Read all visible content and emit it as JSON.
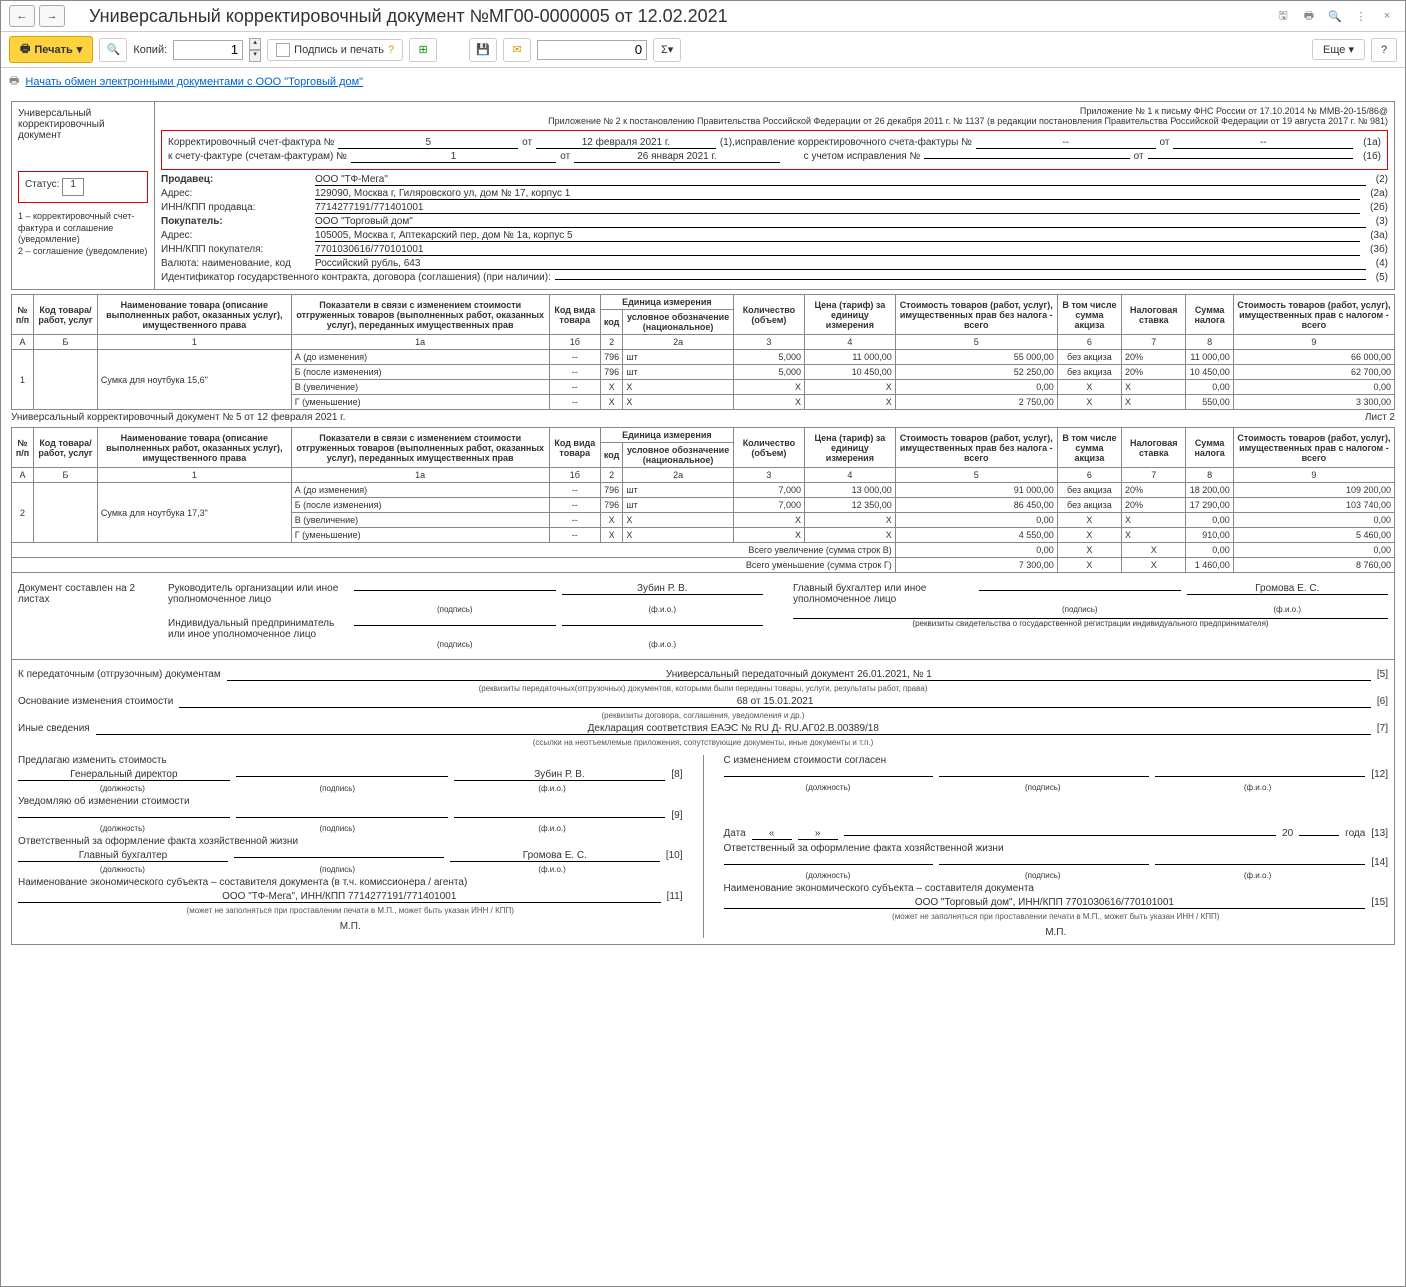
{
  "title": "Универсальный корректировочный документ №МГ00-0000005 от 12.02.2021",
  "toolbar": {
    "print": "Печать",
    "copies_label": "Копий:",
    "copies": "1",
    "sign": "Подпись и печать",
    "sum": "0",
    "more": "Еще",
    "help": "?"
  },
  "link": "Начать обмен электронными документами с ООО \"Торговый дом\"",
  "left": {
    "doc_type": "Универсальный корректировочный документ",
    "status_label": "Статус:",
    "status": "1",
    "legend": "1 – корректировочный счет-фактура и соглашение (уведомление)\n2 – соглашение (уведомление)"
  },
  "header": {
    "note1": "Приложение № 1 к письму ФНС России от 17.10.2014 № ММВ-20-15/86@",
    "note2": "Приложение № 2 к постановлению Правительства Российской Федерации от 26 декабря 2011 г. № 1137 (в редакции постановления Правительства Российской Федерации от 19 августа 2017 г. № 981)",
    "corr_sf_label": "Корректировочный счет-фактура №",
    "corr_sf_no": "5",
    "from": "от",
    "corr_sf_date": "12 февраля 2021 г.",
    "p1": "(1),",
    "ispr_label": "исправление корректировочного счета-фактуры №",
    "ispr_no": "--",
    "ispr_date": "--",
    "p1a": "(1а)",
    "to_sf_label": "к счету-фактуре (счетам-фактурам) №",
    "to_sf_no": "1",
    "to_sf_date": "26 января 2021 г.",
    "with_ispr": "с учетом исправления №",
    "p1b": "(1б)",
    "seller_label": "Продавец:",
    "seller": "ООО \"ТФ-Мега\"",
    "p2": "(2)",
    "addr_label": "Адрес:",
    "seller_addr": "129090, Москва г, Гиляровского ул, дом № 17, корпус 1",
    "p2a": "(2а)",
    "inn_s_label": "ИНН/КПП продавца:",
    "inn_s": "7714277191/771401001",
    "p2b": "(2б)",
    "buyer_label": "Покупатель:",
    "buyer": "ООО \"Торговый дом\"",
    "p3": "(3)",
    "buyer_addr": "105005, Москва г, Аптекарский пер, дом № 1а, корпус 5",
    "p3a": "(3а)",
    "inn_b_label": "ИНН/КПП покупателя:",
    "inn_b": "7701030616/770101001",
    "p3b": "(3б)",
    "currency_label": "Валюта: наименование, код",
    "currency": "Российский рубль, 643",
    "p4": "(4)",
    "gk_label": "Идентификатор государственного контракта, договора (соглашения) (при наличии):",
    "p5": "(5)"
  },
  "table_headers": {
    "n": "№ п/п",
    "code": "Код товара/ работ, услуг",
    "name": "Наименование товара (описание выполненных работ, оказанных услуг), имущественного права",
    "indicators": "Показатели в связи с изменением стоимости отгруженных товаров (выполненных работ, оказанных услуг), переданных имущественных прав",
    "code_type": "Код вида товара",
    "unit": "Единица измерения",
    "unit_code": "код",
    "unit_name": "условное обозначение (национальное)",
    "qty": "Количество (объем)",
    "price": "Цена (тариф) за единицу измерения",
    "cost_wo": "Стоимость товаров (работ, услуг), имущественных прав без налога - всего",
    "excise": "В том числе сумма акциза",
    "rate": "Налоговая ставка",
    "tax": "Сумма налога",
    "cost_w": "Стоимость товаров (работ, услуг), имущественных прав с налогом - всего"
  },
  "col_nums": {
    "a": "А",
    "b": "Б",
    "c1": "1",
    "c1a": "1а",
    "c1b": "1б",
    "c2": "2",
    "c2a": "2а",
    "c3": "3",
    "c4": "4",
    "c5": "5",
    "c6": "6",
    "c7": "7",
    "c8": "8",
    "c9": "9"
  },
  "rows1": [
    {
      "n": "1",
      "name": "Сумка для ноутбука 15,6\"",
      "sub": [
        {
          "t": "А (до изменения)",
          "c1b": "--",
          "c2": "796",
          "c2a": "шт",
          "c3": "5,000",
          "c4": "11 000,00",
          "c5": "55 000,00",
          "c6": "без акциза",
          "c7": "20%",
          "c8": "11 000,00",
          "c9": "66 000,00"
        },
        {
          "t": "Б (после изменения)",
          "c1b": "--",
          "c2": "796",
          "c2a": "шт",
          "c3": "5,000",
          "c4": "10 450,00",
          "c5": "52 250,00",
          "c6": "без акциза",
          "c7": "20%",
          "c8": "10 450,00",
          "c9": "62 700,00"
        },
        {
          "t": "В (увеличение)",
          "c1b": "--",
          "c2": "X",
          "c2a": "X",
          "c3": "X",
          "c4": "X",
          "c5": "0,00",
          "c6": "X",
          "c7": "X",
          "c8": "0,00",
          "c9": "0,00"
        },
        {
          "t": "Г (уменьшение)",
          "c1b": "--",
          "c2": "X",
          "c2a": "X",
          "c3": "X",
          "c4": "X",
          "c5": "2 750,00",
          "c6": "X",
          "c7": "X",
          "c8": "550,00",
          "c9": "3 300,00"
        }
      ]
    }
  ],
  "sheet2_label": "Универсальный корректировочный документ № 5 от 12 февраля 2021 г.",
  "sheet2": "Лист 2",
  "rows2": [
    {
      "n": "2",
      "name": "Сумка для ноутбука 17,3\"",
      "sub": [
        {
          "t": "А (до изменения)",
          "c1b": "--",
          "c2": "796",
          "c2a": "шт",
          "c3": "7,000",
          "c4": "13 000,00",
          "c5": "91 000,00",
          "c6": "без акциза",
          "c7": "20%",
          "c8": "18 200,00",
          "c9": "109 200,00"
        },
        {
          "t": "Б (после изменения)",
          "c1b": "--",
          "c2": "796",
          "c2a": "шт",
          "c3": "7,000",
          "c4": "12 350,00",
          "c5": "86 450,00",
          "c6": "без акциза",
          "c7": "20%",
          "c8": "17 290,00",
          "c9": "103 740,00"
        },
        {
          "t": "В (увеличение)",
          "c1b": "--",
          "c2": "X",
          "c2a": "X",
          "c3": "X",
          "c4": "X",
          "c5": "0,00",
          "c6": "X",
          "c7": "X",
          "c8": "0,00",
          "c9": "0,00"
        },
        {
          "t": "Г (уменьшение)",
          "c1b": "--",
          "c2": "X",
          "c2a": "X",
          "c3": "X",
          "c4": "X",
          "c5": "4 550,00",
          "c6": "X",
          "c7": "X",
          "c8": "910,00",
          "c9": "5 460,00"
        }
      ]
    }
  ],
  "totals": {
    "inc_label": "Всего увеличение (сумма строк В)",
    "inc": {
      "c5": "0,00",
      "c6": "X",
      "c7": "X",
      "c8": "0,00",
      "c9": "0,00"
    },
    "dec_label": "Всего уменьшение (сумма строк Г)",
    "dec": {
      "c5": "7 300,00",
      "c6": "X",
      "c7": "X",
      "c8": "1 460,00",
      "c9": "8 760,00"
    }
  },
  "sig": {
    "doc_on": "Документ составлен на 2 листах",
    "head_label": "Руководитель организации или иное уполномоченное лицо",
    "head_name": "Зубин Р. В.",
    "chief_acc_label": "Главный бухгалтер или иное уполномоченное лицо",
    "chief_name": "Громова Е. С.",
    "ip_label": "Индивидуальный предприниматель или иное уполномоченное лицо",
    "podpis": "(подпись)",
    "fio": "(ф.и.о.)",
    "rekv": "(реквизиты свидетельства о государственной  регистрации индивидуального предпринимателя)"
  },
  "bottom": {
    "p5_label": "К передаточным (отгрузочным) документам",
    "p5_val": "Универсальный передаточный документ 26.01.2021, № 1",
    "p5": "[5]",
    "p5_sub": "(реквизиты передаточных(отгрузочных) документов, которыми были переданы товары, услуги, результаты работ, права)",
    "p6_label": "Основание изменения стоимости",
    "p6_val": "68 от 15.01.2021",
    "p6": "[6]",
    "p6_sub": "(реквизиты договора, соглашения, уведомления и др.)",
    "p7_label": "Иные сведения",
    "p7_val": "Декларация соответствия ЕАЭС № RU Д- RU.АГ02.В.00389/18",
    "p7": "[7]",
    "p7_sub": "(ссылки на неотъемлемые приложения, сопутствующие документы, иные документы и т.п.)",
    "left": {
      "propose": "Предлагаю изменить стоимость",
      "gen_dir": "Генеральный директор",
      "zubin": "Зубин Р. В.",
      "p8": "[8]",
      "notify": "Уведомляю об изменении стоимости",
      "p9": "[9]",
      "resp": "Ответственный за оформление факта хозяйственной жизни",
      "gl_buh": "Главный бухгалтер",
      "gromova": "Громова Е. С.",
      "p10": "[10]",
      "econom": "Наименование экономического субъекта – составителя документа (в т.ч. комиссионера / агента)",
      "econom_val": "ООО \"ТФ-Мега\", ИНН/КПП 7714277191/771401001",
      "p11": "[11]",
      "mp": "М.П."
    },
    "right": {
      "agree": "С изменением стоимости согласен",
      "p12": "[12]",
      "date": "Дата",
      "year": "20",
      "year2": "года",
      "p13": "[13]",
      "resp": "Ответственный за оформление факта хозяйственной жизни",
      "p14": "[14]",
      "econom": "Наименование экономического субъекта – составителя документа",
      "econom_val": "ООО \"Торговый дом\", ИНН/КПП 7701030616/770101001",
      "p15": "[15]",
      "mp": "М.П."
    },
    "dolzh": "(должность)",
    "note": "(может не заполняться при проставлении печати в М.П., может быть указан ИНН / КПП)"
  }
}
